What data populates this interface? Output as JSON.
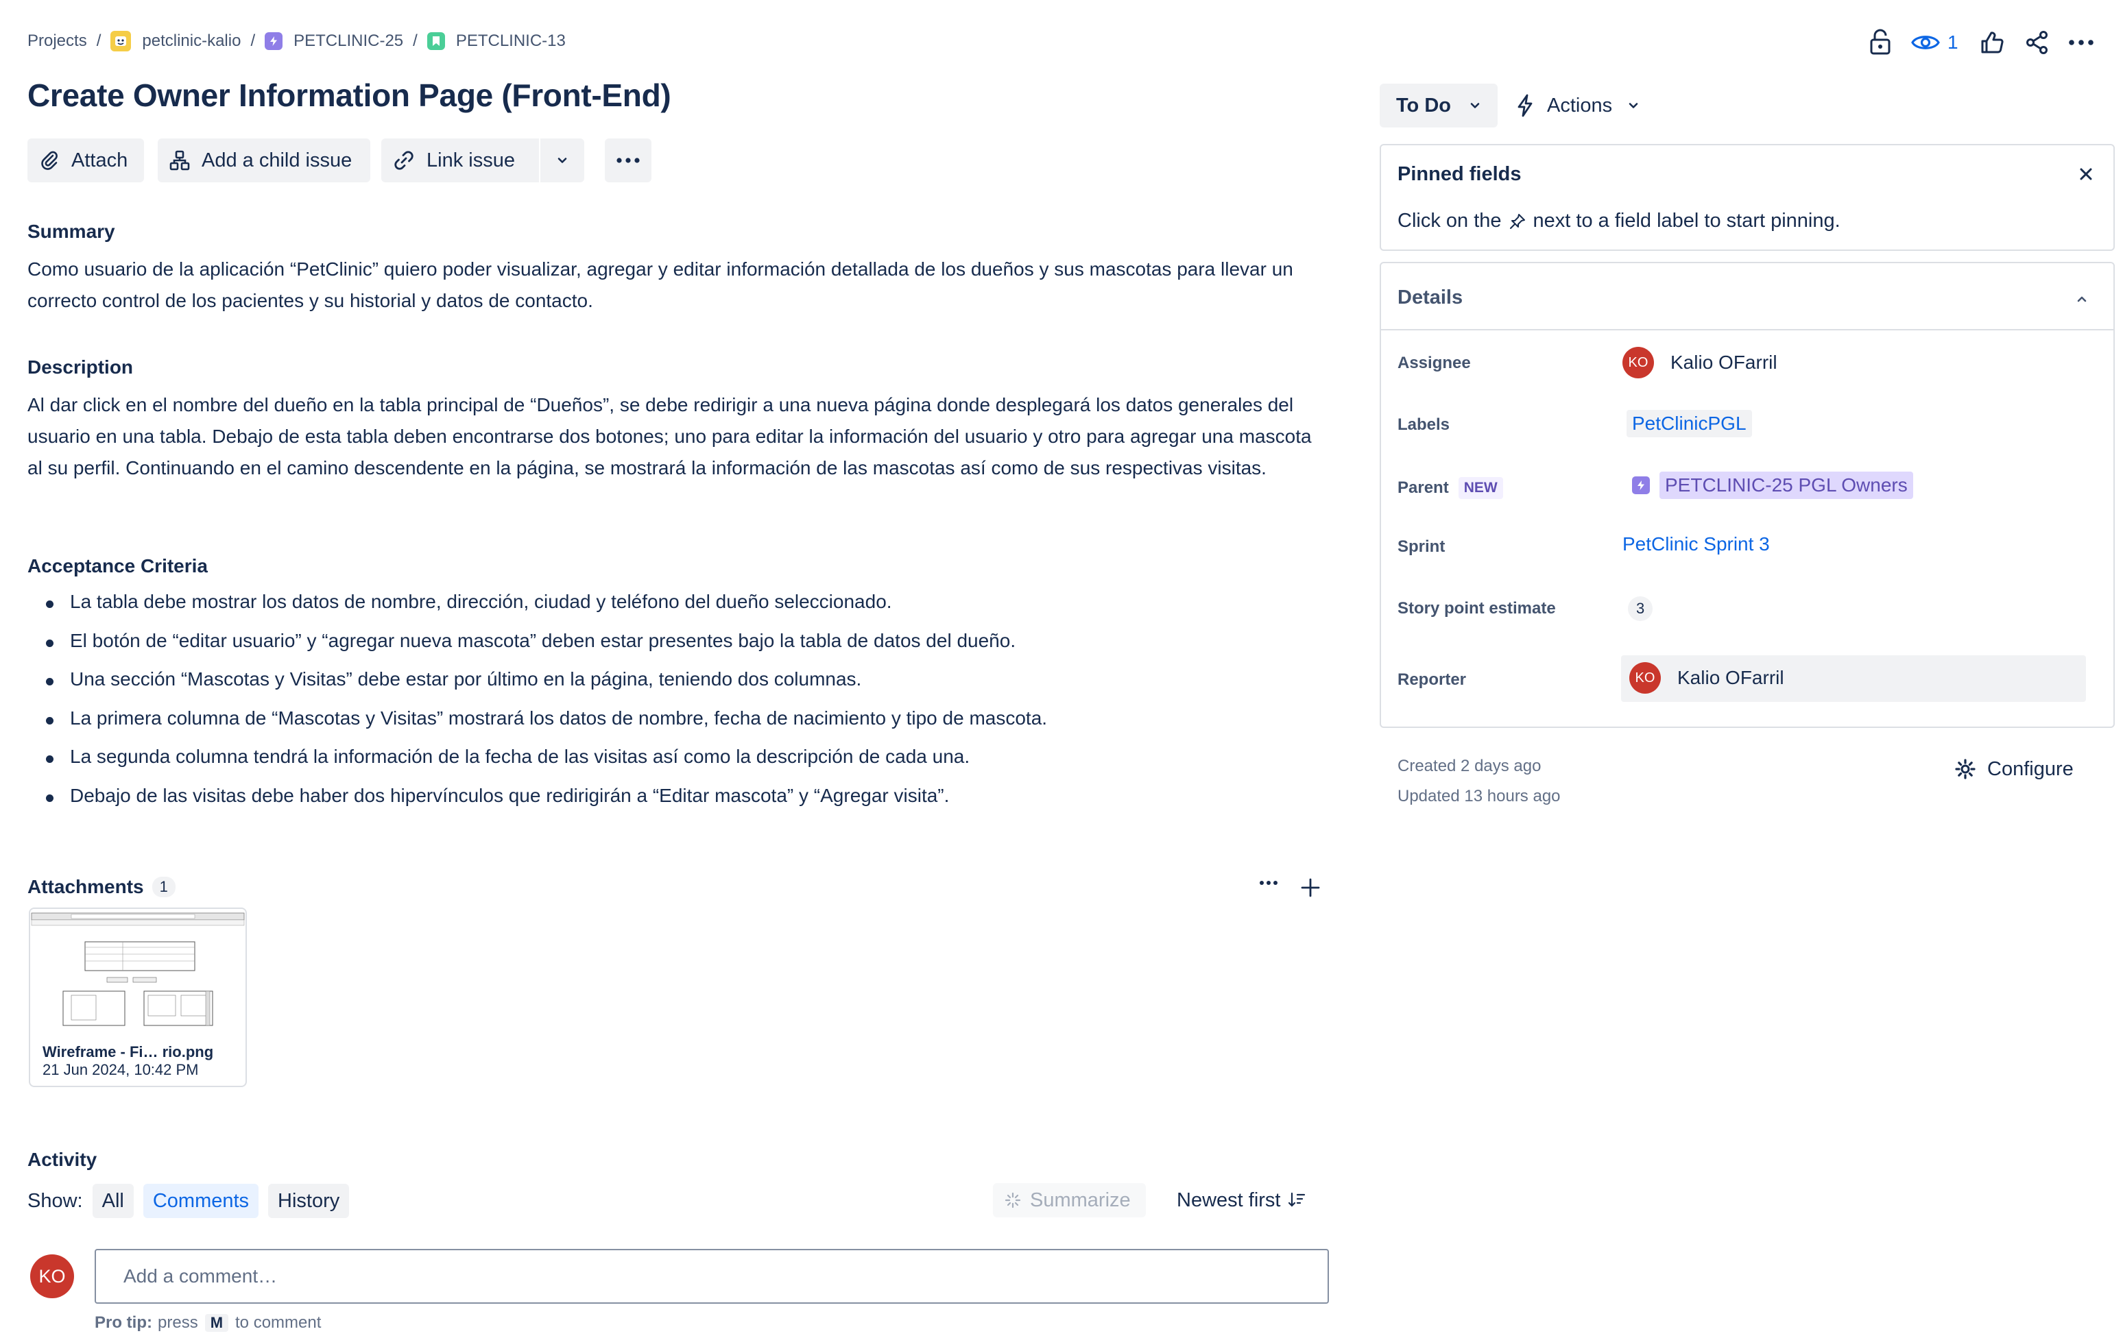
{
  "breadcrumb": {
    "projects": "Projects",
    "project": "petclinic-kalio",
    "epic": "PETCLINIC-25",
    "issue": "PETCLINIC-13",
    "separator": "/"
  },
  "issue": {
    "title": "Create Owner Information Page (Front-End)"
  },
  "toolbar": {
    "attach": "Attach",
    "add_child": "Add a child issue",
    "link_issue": "Link issue"
  },
  "summary": {
    "heading": "Summary",
    "text": "Como usuario de la aplicación “PetClinic” quiero poder visualizar, agregar y editar información detallada de los dueños y sus mascotas para llevar un correcto control de los pacientes y su historial y datos de contacto."
  },
  "description": {
    "heading": "Description",
    "text": "Al dar click en el nombre del dueño en la tabla principal de “Dueños”, se debe redirigir a una nueva página donde desplegará los datos generales del usuario en una tabla. Debajo de esta tabla deben encontrarse dos botones; uno para editar la información del usuario y otro para agregar una mascota al su perfil. Continuando en el camino descendente en la página, se mostrará la información de las mascotas así como de sus respectivas visitas."
  },
  "acceptance": {
    "heading": "Acceptance Criteria",
    "items": [
      "La tabla debe mostrar los datos de nombre, dirección, ciudad y teléfono del dueño seleccionado.",
      "El botón de “editar usuario” y “agregar nueva mascota” deben estar presentes bajo la tabla de datos del dueño.",
      "Una sección “Mascotas y Visitas” debe estar por último en la página, teniendo dos columnas.",
      "La primera columna de “Mascotas y Visitas” mostrará los datos de nombre, fecha de nacimiento y tipo de mascota.",
      "La segunda columna tendrá la información de la fecha de las visitas así como la descripción de cada una.",
      "Debajo de las visitas debe haber dos hipervínculos que redirigirán a “Editar mascota” y “Agregar visita”."
    ]
  },
  "attachments": {
    "heading": "Attachments",
    "count": "1",
    "file_name": "Wireframe - Fi… rio.png",
    "file_date": "21 Jun 2024, 10:42 PM"
  },
  "activity": {
    "heading": "Activity",
    "show_label": "Show:",
    "filters": [
      "All",
      "Comments",
      "History"
    ],
    "selected_filter": "Comments",
    "summarize": "Summarize",
    "sort": "Newest first",
    "comment_placeholder": "Add a comment…",
    "protip_label": "Pro tip:",
    "protip_text": "press",
    "protip_key": "M",
    "protip_after": "to comment"
  },
  "user": {
    "initials": "KO"
  },
  "header_actions": {
    "watch_count": "1"
  },
  "status": {
    "label": "To Do",
    "actions": "Actions"
  },
  "pinned": {
    "heading": "Pinned fields",
    "text_before": "Click on the",
    "text_after": "next to a field label to start pinning."
  },
  "details": {
    "heading": "Details",
    "assignee_label": "Assignee",
    "assignee": "Kalio OFarril",
    "labels_label": "Labels",
    "labels_value": "PetClinicPGL",
    "parent_label": "Parent",
    "parent_new": "NEW",
    "parent_value": "PETCLINIC-25 PGL Owners",
    "sprint_label": "Sprint",
    "sprint_value": "PetClinic Sprint 3",
    "points_label": "Story point estimate",
    "points_value": "3",
    "reporter_label": "Reporter",
    "reporter": "Kalio OFarril"
  },
  "meta": {
    "created": "Created 2 days ago",
    "updated": "Updated 13 hours ago",
    "configure": "Configure"
  },
  "colors": {
    "text": "#172B4D",
    "link": "#0C66E4",
    "avatar": "#C9372C",
    "epic_purple": "#8F7EE7",
    "story_green": "#4BCE97"
  },
  "icons": [
    "lock-icon",
    "eye-icon",
    "like-icon",
    "share-icon",
    "more-icon",
    "paperclip-icon",
    "hierarchy-icon",
    "link-icon",
    "chevron-down-icon",
    "lightning-icon",
    "close-icon",
    "pin-icon",
    "chevron-up-icon",
    "gear-icon",
    "sparkle-icon",
    "sort-icon",
    "plus-icon"
  ]
}
